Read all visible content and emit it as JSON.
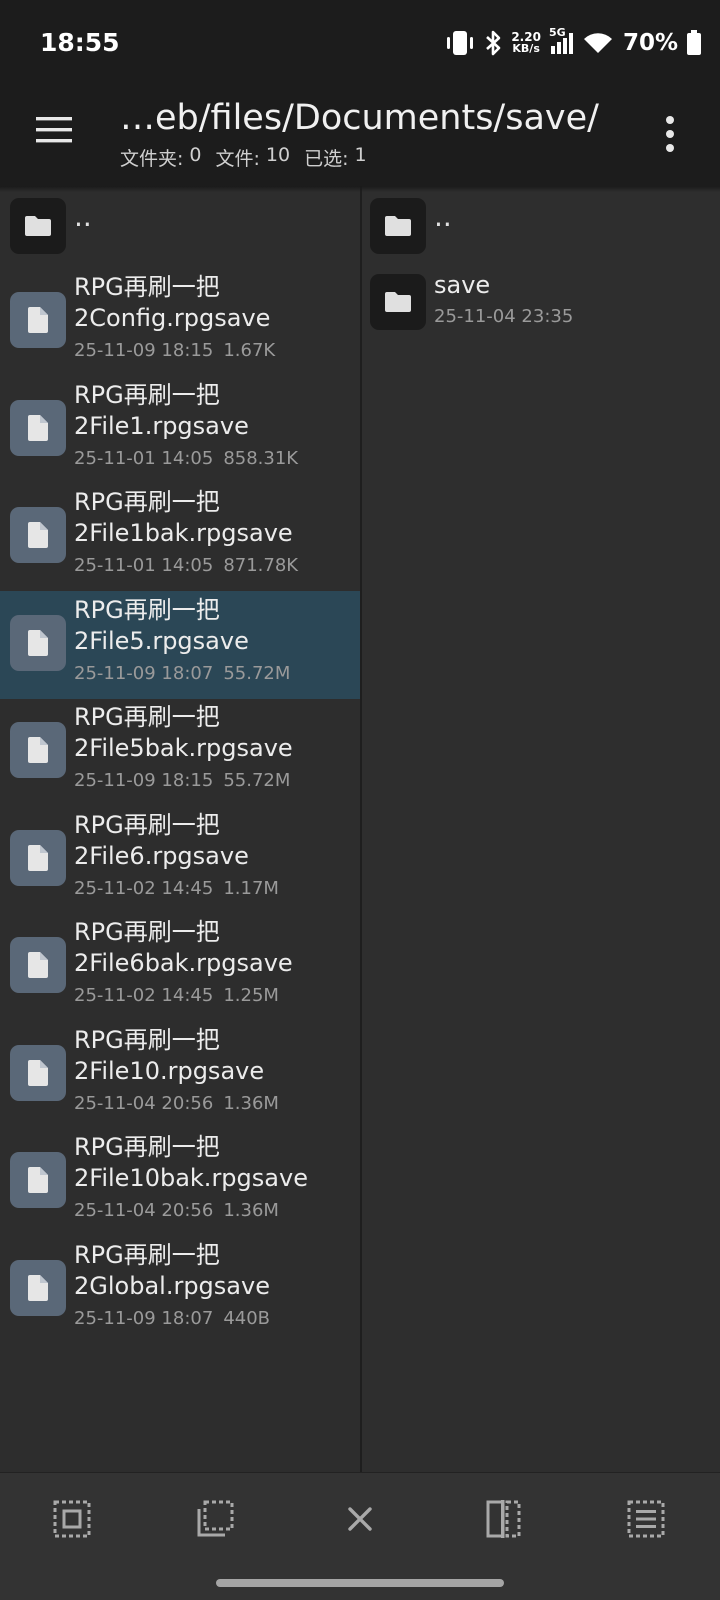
{
  "status_bar": {
    "time": "18:55",
    "net_speed_value": "2.20",
    "net_speed_unit": "KB/s",
    "network_type": "5G",
    "battery": "70%",
    "icons": [
      "vibrate-icon",
      "bluetooth-icon",
      "signal-icon",
      "wifi-icon",
      "battery-icon"
    ]
  },
  "toolbar": {
    "menu_icon": "hamburger-menu-icon",
    "path": "…eb/files/Documents/save/",
    "folders_label": "文件夹:",
    "folders_count": "0",
    "files_label": "文件:",
    "files_count": "10",
    "selected_label": "已选:",
    "selected_count": "1",
    "more_icon": "more-vert-icon"
  },
  "left_pane": {
    "parent_label": "..",
    "items": [
      {
        "line1": "RPG再刷一把",
        "line2": "2Config.rpgsave",
        "date": "25-11-09 18:15",
        "size": "1.67K",
        "selected": false
      },
      {
        "line1": "RPG再刷一把",
        "line2": "2File1.rpgsave",
        "date": "25-11-01 14:05",
        "size": "858.31K",
        "selected": false
      },
      {
        "line1": "RPG再刷一把",
        "line2": "2File1bak.rpgsave",
        "date": "25-11-01 14:05",
        "size": "871.78K",
        "selected": false
      },
      {
        "line1": "RPG再刷一把",
        "line2": "2File5.rpgsave",
        "date": "25-11-09 18:07",
        "size": "55.72M",
        "selected": true
      },
      {
        "line1": "RPG再刷一把",
        "line2": "2File5bak.rpgsave",
        "date": "25-11-09 18:15",
        "size": "55.72M",
        "selected": false
      },
      {
        "line1": "RPG再刷一把",
        "line2": "2File6.rpgsave",
        "date": "25-11-02 14:45",
        "size": "1.17M",
        "selected": false
      },
      {
        "line1": "RPG再刷一把",
        "line2": "2File6bak.rpgsave",
        "date": "25-11-02 14:45",
        "size": "1.25M",
        "selected": false
      },
      {
        "line1": "RPG再刷一把",
        "line2": "2File10.rpgsave",
        "date": "25-11-04 20:56",
        "size": "1.36M",
        "selected": false
      },
      {
        "line1": "RPG再刷一把",
        "line2": "2File10bak.rpgsave",
        "date": "25-11-04 20:56",
        "size": "1.36M",
        "selected": false
      },
      {
        "line1": "RPG再刷一把",
        "line2": "2Global.rpgsave",
        "date": "25-11-09 18:07",
        "size": "440B",
        "selected": false
      }
    ]
  },
  "right_pane": {
    "parent_label": "..",
    "items": [
      {
        "name": "save",
        "date": "25-11-04 23:35"
      }
    ]
  },
  "bottom_bar": {
    "buttons": [
      "select-all-icon",
      "select-range-icon",
      "close-icon",
      "split-view-icon",
      "select-list-icon"
    ]
  },
  "colors": {
    "bar_bg": "#1c1c1c",
    "pane_bg": "#2d2d2d",
    "selected_row": "#2b4756",
    "file_icon_bg": "#5a6878",
    "folder_icon_bg": "#1b1b1b"
  }
}
